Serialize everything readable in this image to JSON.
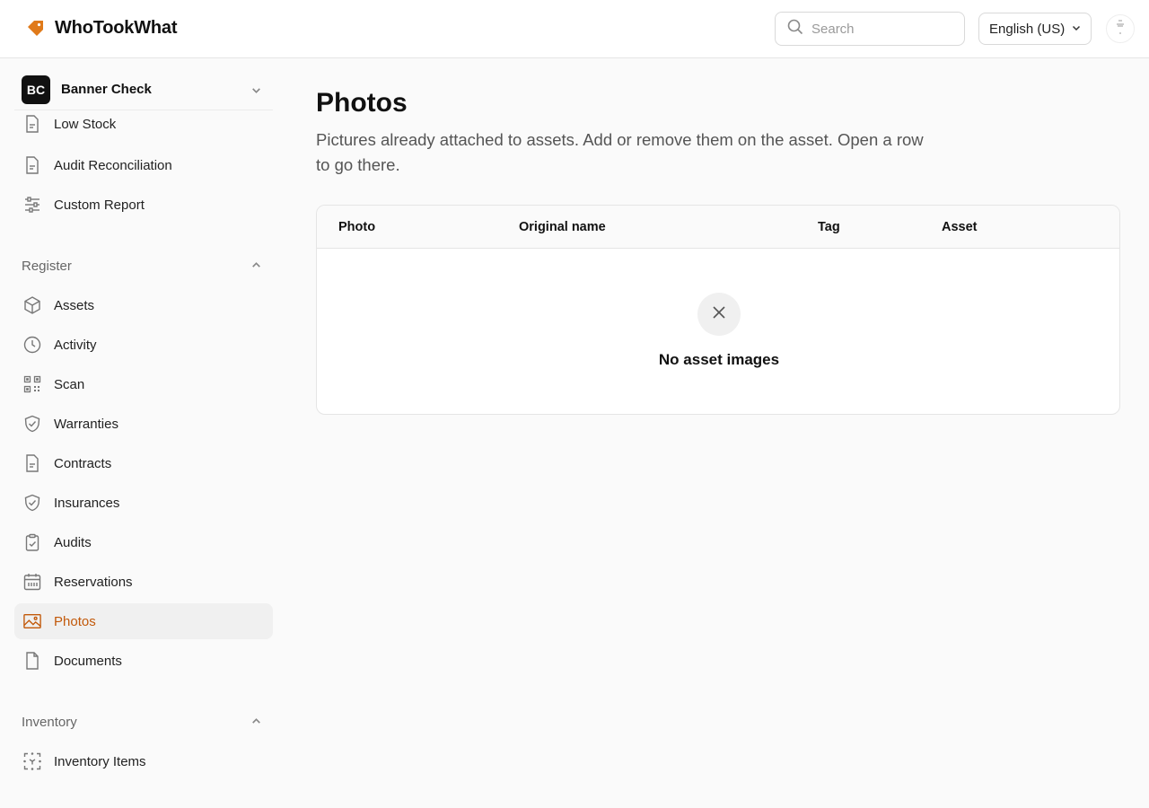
{
  "app": {
    "name": "WhoTookWhat",
    "accent": "#c2590a",
    "logo_color": "#e07a1a"
  },
  "header": {
    "search_placeholder": "Search",
    "language": "English (US)"
  },
  "sidebar": {
    "org": {
      "initials": "BC",
      "name": "Banner Check"
    },
    "reports_items": [
      {
        "label": "Low Stock",
        "icon": "document-icon"
      },
      {
        "label": "Audit Reconciliation",
        "icon": "document-icon"
      },
      {
        "label": "Custom Report",
        "icon": "sliders-icon"
      }
    ],
    "register": {
      "title": "Register",
      "items": [
        {
          "label": "Assets",
          "icon": "box-icon"
        },
        {
          "label": "Activity",
          "icon": "clock-icon"
        },
        {
          "label": "Scan",
          "icon": "qr-code-icon"
        },
        {
          "label": "Warranties",
          "icon": "shield-check-icon"
        },
        {
          "label": "Contracts",
          "icon": "document-icon"
        },
        {
          "label": "Insurances",
          "icon": "shield-check-icon"
        },
        {
          "label": "Audits",
          "icon": "clipboard-check-icon"
        },
        {
          "label": "Reservations",
          "icon": "calendar-icon"
        },
        {
          "label": "Photos",
          "icon": "image-icon",
          "active": true
        },
        {
          "label": "Documents",
          "icon": "file-icon"
        }
      ]
    },
    "inventory": {
      "title": "Inventory",
      "items": [
        {
          "label": "Inventory Items",
          "icon": "scan-box-icon"
        }
      ]
    }
  },
  "main": {
    "title": "Photos",
    "subtitle": "Pictures already attached to assets. Add or remove them on the asset. Open a row to go there.",
    "table": {
      "columns": [
        "Photo",
        "Original name",
        "Tag",
        "Asset"
      ],
      "rows": [],
      "empty_message": "No asset images"
    }
  }
}
